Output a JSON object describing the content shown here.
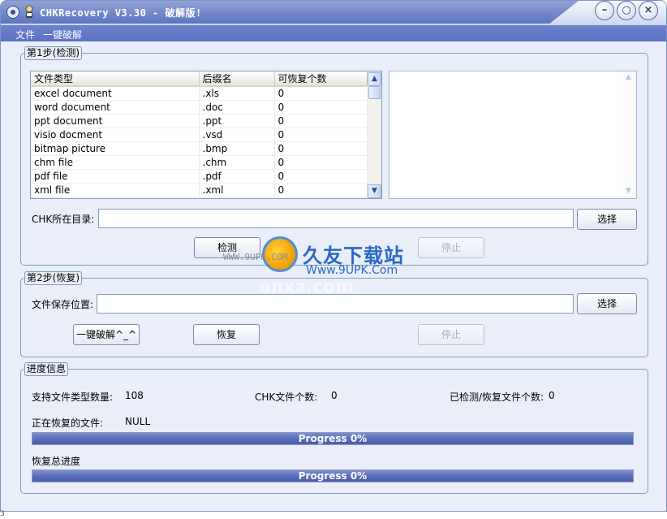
{
  "window": {
    "title": "CHKRecovery V3.30 - 破解版!",
    "minimize_symbol": "–",
    "restore_symbol": "○",
    "close_symbol": "×"
  },
  "menu": {
    "file": "文件",
    "crack": "一键破解"
  },
  "step1": {
    "legend": "第1步(检测)",
    "columns": [
      "文件类型",
      "后缀名",
      "可恢复个数"
    ],
    "rows": [
      [
        "excel document",
        ".xls",
        "0"
      ],
      [
        "word document",
        ".doc",
        "0"
      ],
      [
        "ppt document",
        ".ppt",
        "0"
      ],
      [
        "visio docment",
        ".vsd",
        "0"
      ],
      [
        "bitmap picture",
        ".bmp",
        "0"
      ],
      [
        "chm file",
        ".chm",
        "0"
      ],
      [
        "pdf file",
        ".pdf",
        "0"
      ],
      [
        "xml file",
        ".xml",
        "0"
      ]
    ],
    "dir_label": "CHK所在目录:",
    "dir_value": "",
    "browse": "选择",
    "detect": "检测",
    "stop": "停止"
  },
  "step2": {
    "legend": "第2步(恢复)",
    "save_label": "文件保存位置:",
    "save_value": "",
    "browse": "选择",
    "crack": "一键破解^_^",
    "recover": "恢复",
    "stop": "停止"
  },
  "progress": {
    "legend": "进度信息",
    "supported_label": "支持文件类型数量:",
    "supported_value": "108",
    "chk_label": "CHK文件个数:",
    "chk_value": "0",
    "checked_label": "已检测/恢复文件个数:",
    "checked_value": "0",
    "current_label": "正在恢复的文件:",
    "current_value": "NULL",
    "bar1_text": "Progress 0%",
    "bar1_fraction": 0,
    "total_label": "恢复总进度",
    "bar2_text": "Progress 0%",
    "bar2_fraction": 0
  },
  "watermark": {
    "title": "久友下载站",
    "url": "Www.9UPK.Com",
    "small": "WWW.9UPK.COM",
    "ghost": "anxz.com"
  },
  "footer": {
    "text": "3"
  },
  "colors": {
    "accent": "#5a72c2",
    "panel": "#e9eef9",
    "border": "#7f9db9"
  }
}
